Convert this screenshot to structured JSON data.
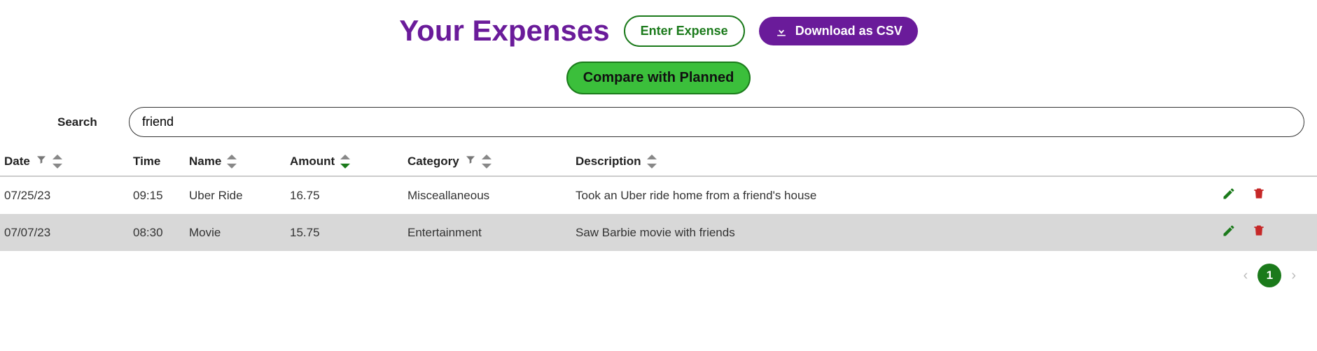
{
  "header": {
    "title": "Your Expenses",
    "enter_label": "Enter Expense",
    "download_label": "Download as CSV",
    "compare_label": "Compare with Planned"
  },
  "search": {
    "label": "Search",
    "value": "friend"
  },
  "columns": {
    "date": "Date",
    "time": "Time",
    "name": "Name",
    "amount": "Amount",
    "category": "Category",
    "description": "Description"
  },
  "rows": [
    {
      "date": "07/25/23",
      "time": "09:15",
      "name": "Uber Ride",
      "amount": "16.75",
      "category": "Misceallaneous",
      "description": "Took an Uber ride home from a friend's house"
    },
    {
      "date": "07/07/23",
      "time": "08:30",
      "name": "Movie",
      "amount": "15.75",
      "category": "Entertainment",
      "description": "Saw Barbie movie with friends"
    }
  ],
  "pagination": {
    "current": "1"
  }
}
